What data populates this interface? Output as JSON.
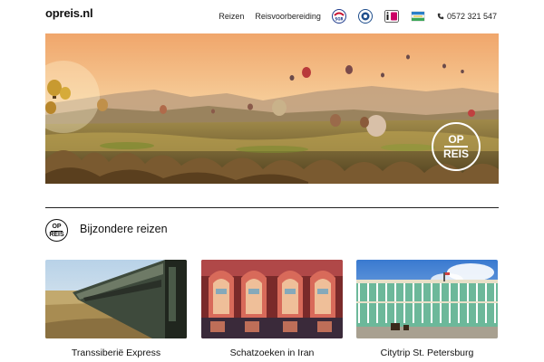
{
  "site": {
    "logo": "opreis.nl"
  },
  "nav": {
    "links": [
      {
        "label": "Reizen"
      },
      {
        "label": "Reisvoorbereiding"
      }
    ],
    "badges": [
      {
        "name": "sgr-badge",
        "color": "#c8102e",
        "text": "SGR"
      },
      {
        "name": "anvr-badge",
        "color": "#1f4e8c",
        "text": ""
      },
      {
        "name": "ideal-badge",
        "color": "#cc0066",
        "text": "iD"
      },
      {
        "name": "flag-badge",
        "color": "#3aa757",
        "text": ""
      }
    ],
    "phone": "0572 321 547"
  },
  "hero": {
    "brand_top": "OP",
    "brand_bottom": "REIS"
  },
  "section": {
    "badge_top": "OP",
    "badge_bottom": "REIS",
    "title": "Bijzondere reizen"
  },
  "cards": [
    {
      "title": "Transsiberië Express"
    },
    {
      "title": "Schatzoeken in Iran"
    },
    {
      "title": "Citytrip St. Petersburg"
    }
  ],
  "colors": {
    "accent": "#111111",
    "sky_top": "#f2b97a",
    "hills": "#6b5a2a"
  }
}
